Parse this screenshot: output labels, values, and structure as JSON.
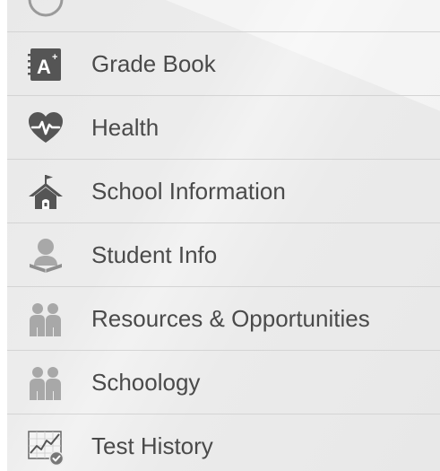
{
  "menu": {
    "items": [
      {
        "label": "Grade Book",
        "icon": "grade-book-icon"
      },
      {
        "label": "Health",
        "icon": "health-heart-icon"
      },
      {
        "label": "School Information",
        "icon": "school-house-icon"
      },
      {
        "label": "Student Info",
        "icon": "student-reading-icon"
      },
      {
        "label": "Resources & Opportunities",
        "icon": "people-group-icon"
      },
      {
        "label": "Schoology",
        "icon": "people-group-icon"
      },
      {
        "label": "Test History",
        "icon": "chart-check-icon"
      }
    ]
  },
  "colors": {
    "background": "#ebebeb",
    "divider": "#d4d4d4",
    "text": "#4a4a4a",
    "icon_dark": "#555555",
    "icon_light": "#a8a8a8"
  }
}
